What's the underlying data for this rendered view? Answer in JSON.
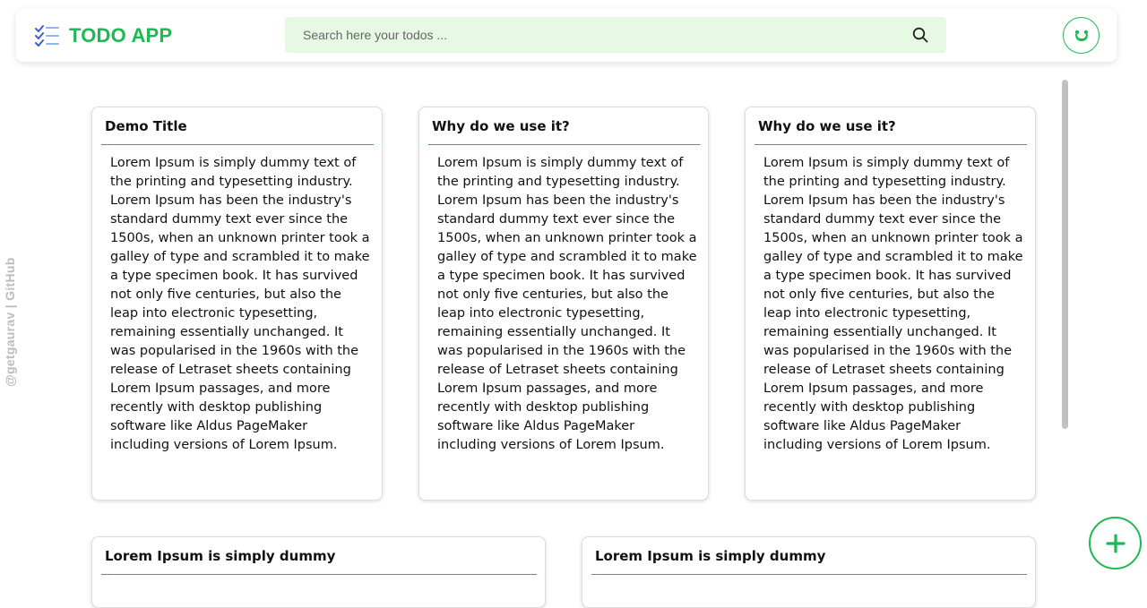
{
  "header": {
    "app_title": "TODO APP",
    "search_placeholder": "Search here your todos ...",
    "search_value": "",
    "logo_icon": "checklist-icon",
    "search_icon": "search-icon",
    "avatar_icon": "smiley-icon"
  },
  "watermark": "@getgaurav | GitHub",
  "colors": {
    "accent": "#1db954",
    "search_bg": "#e6f9e3",
    "logo_icon": "#3b5bdb"
  },
  "todos": [
    {
      "title": "Demo Title",
      "body": "Lorem Ipsum is simply dummy text of the printing and typesetting industry. Lorem Ipsum has been the industry's standard dummy text ever since the 1500s, when an unknown printer took a galley of type and scrambled it to make a type specimen book. It has survived not only five centuries, but also the leap into electronic typesetting, remaining essentially unchanged. It was popularised in the 1960s with the release of Letraset sheets containing Lorem Ipsum passages, and more recently with desktop publishing software like Aldus PageMaker including versions of Lorem Ipsum."
    },
    {
      "title": "Why do we use it?",
      "body": "Lorem Ipsum is simply dummy text of the printing and typesetting industry. Lorem Ipsum has been the industry's standard dummy text ever since the 1500s, when an unknown printer took a galley of type and scrambled it to make a type specimen book. It has survived not only five centuries, but also the leap into electronic typesetting, remaining essentially unchanged. It was popularised in the 1960s with the release of Letraset sheets containing Lorem Ipsum passages, and more recently with desktop publishing software like Aldus PageMaker including versions of Lorem Ipsum."
    },
    {
      "title": "Why do we use it?",
      "body": "Lorem Ipsum is simply dummy text of the printing and typesetting industry. Lorem Ipsum has been the industry's standard dummy text ever since the 1500s, when an unknown printer took a galley of type and scrambled it to make a type specimen book. It has survived not only five centuries, but also the leap into electronic typesetting, remaining essentially unchanged. It was popularised in the 1960s with the release of Letraset sheets containing Lorem Ipsum passages, and more recently with desktop publishing software like Aldus PageMaker including versions of Lorem Ipsum."
    },
    {
      "title": "Lorem Ipsum is simply dummy",
      "body": ""
    },
    {
      "title": "Lorem Ipsum is simply dummy",
      "body": ""
    }
  ],
  "fab": {
    "icon": "plus-icon"
  }
}
